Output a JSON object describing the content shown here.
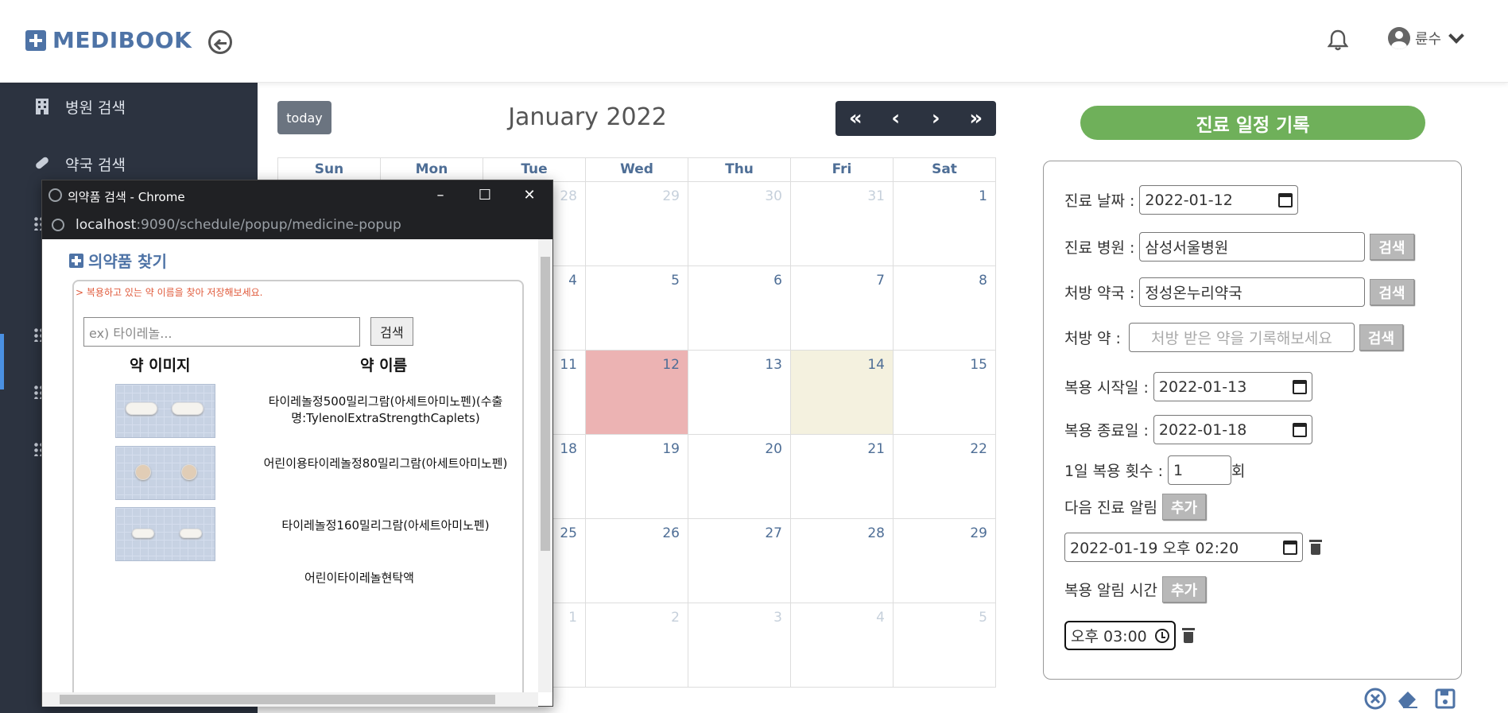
{
  "header": {
    "logo_text": "MEDIBOOK",
    "user_name": "륜수"
  },
  "sidebar": {
    "items": [
      {
        "label": "병원 검색",
        "icon": "hospital-icon"
      },
      {
        "label": "약국 검색",
        "icon": "pill-icon"
      }
    ]
  },
  "calendar": {
    "today_label": "today",
    "title": "January 2022",
    "nav": [
      "«",
      "‹",
      "›",
      "»"
    ],
    "weekdays": [
      "Sun",
      "Mon",
      "Tue",
      "Wed",
      "Thu",
      "Fri",
      "Sat"
    ],
    "weeks": [
      [
        "",
        "",
        "28",
        "29",
        "30",
        "31",
        "1"
      ],
      [
        "",
        "",
        "4",
        "5",
        "6",
        "7",
        "8"
      ],
      [
        "",
        "",
        "11",
        "12",
        "13",
        "14",
        "15"
      ],
      [
        "",
        "",
        "18",
        "19",
        "20",
        "21",
        "22"
      ],
      [
        "",
        "",
        "25",
        "26",
        "27",
        "28",
        "29"
      ],
      [
        "",
        "",
        "1",
        "2",
        "3",
        "4",
        "5"
      ]
    ]
  },
  "record": {
    "title": "진료 일정 기록",
    "visit_date_label": "진료 날짜 :",
    "visit_date": "2022-01-12",
    "hospital_label": "진료 병원 :",
    "hospital": "삼성서울병원",
    "pharmacy_label": "처방 약국 :",
    "pharmacy": "정성온누리약국",
    "medicine_label": "처방 약 :",
    "medicine_placeholder": "처방 받은 약을 기록해보세요",
    "search_label": "검색",
    "start_label": "복용 시작일 :",
    "start_date": "2022-01-13",
    "end_label": "복용 종료일 :",
    "end_date": "2022-01-18",
    "daily_label": "1일 복용 횟수 :",
    "daily_count": "1",
    "daily_unit": "회",
    "next_alarm_label": "다음 진료 알림",
    "add_label": "추가",
    "next_alarm_value": "2022-01-19  오후 02:20",
    "dose_alarm_label": "복용 알림 시간",
    "dose_alarm_value": "오후 03:00"
  },
  "popup": {
    "window_title": "의약품 검색 - Chrome",
    "url_host": "localhost",
    "url_rest": ":9090/schedule/popup/medicine-popup",
    "heading": "의약품 찾기",
    "hint": "> 복용하고 있는 약 이름을 찾아 저장해보세요.",
    "search_placeholder": "ex) 타이레놀...",
    "search_button": "검색",
    "col_image": "약 이미지",
    "col_name": "약 이름",
    "medicines": [
      "타이레놀정500밀리그람(아세트아미노펜)(수출명:TylenolExtraStrengthCaplets)",
      "어린이용타이레놀정80밀리그람(아세트아미노펜)",
      "타이레놀정160밀리그람(아세트아미노펜)",
      "어린이타이레놀현탁액"
    ]
  }
}
